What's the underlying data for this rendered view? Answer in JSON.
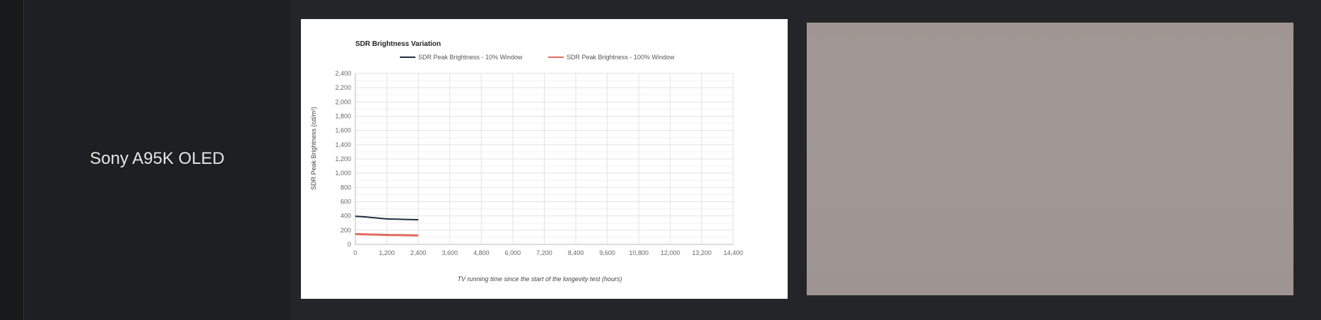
{
  "row": {
    "tv_name": "Sony A95K OLED"
  },
  "colors": {
    "page_bg": "#18191b",
    "text": "#e6e6e6",
    "photo_fill": "#a09592",
    "series_10": "#1f2f3f",
    "series_100": "#e06b5f"
  },
  "chart_data": {
    "type": "line",
    "title": "SDR Brightness Variation",
    "xlabel": "TV running time since the start of the longevity test (hours)",
    "ylabel": "SDR Peak Brightness (cd/m²)",
    "xlim": [
      0,
      14400
    ],
    "ylim": [
      0,
      2400
    ],
    "x_ticks": [
      "0",
      "1,200",
      "2,400",
      "3,600",
      "4,800",
      "6,000",
      "7,200",
      "8,400",
      "9,600",
      "10,800",
      "12,000",
      "13,200",
      "14,400"
    ],
    "y_ticks": [
      "0",
      "200",
      "400",
      "600",
      "800",
      "1,000",
      "1,200",
      "1,400",
      "1,600",
      "1,800",
      "2,000",
      "2,200",
      "2,400"
    ],
    "grid": true,
    "legend": "top",
    "series": [
      {
        "name": "SDR Peak Brightness - 10% Window",
        "color": "#1f2f3f",
        "x": [
          0,
          200,
          400,
          600,
          800,
          1000,
          1200,
          1400,
          1600,
          1800,
          2000,
          2200,
          2400
        ],
        "y": [
          395,
          390,
          385,
          378,
          372,
          365,
          358,
          356,
          354,
          352,
          350,
          348,
          346
        ]
      },
      {
        "name": "SDR Peak Brightness - 100% Window",
        "color": "#e06b5f",
        "x": [
          0,
          200,
          400,
          600,
          800,
          1000,
          1200,
          1400,
          1600,
          1800,
          2000,
          2200,
          2400
        ],
        "y": [
          145,
          143,
          141,
          139,
          137,
          135,
          133,
          132,
          131,
          130,
          129,
          128,
          127
        ]
      }
    ]
  }
}
